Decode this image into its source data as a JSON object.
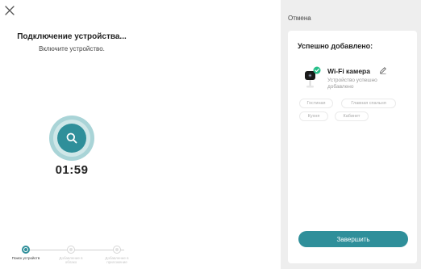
{
  "left": {
    "title": "Подключение устройства...",
    "subtitle": "Включите устройство.",
    "timer": "01:59",
    "steps": [
      {
        "label": "Поиск устройств",
        "state": "active"
      },
      {
        "label": "Добавление в облако",
        "state": "inactive"
      },
      {
        "label": "Добавление в приложение",
        "state": "inactive"
      }
    ]
  },
  "right": {
    "cancel_label": "Отмена",
    "card_title": "Успешно добавлено:",
    "device": {
      "name": "Wi-Fi камера",
      "status": "Устройство успешно добавлено"
    },
    "rooms": [
      "Гостиная",
      "Главная спальня",
      "Кухня",
      "Кабинет"
    ],
    "finish_label": "Завершить"
  },
  "colors": {
    "accent": "#2f8f9a",
    "accent_light": "#a9d4d7",
    "success": "#27c08a",
    "panel_bg": "#eeeeee"
  },
  "icons": [
    "close-icon",
    "search-icon",
    "camera-icon",
    "check-icon",
    "edit-icon"
  ]
}
